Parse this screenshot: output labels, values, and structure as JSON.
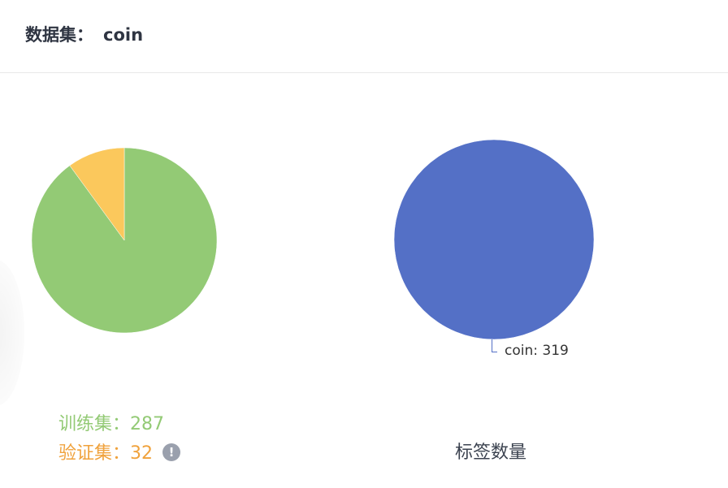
{
  "header": {
    "label": "数据集：",
    "dataset_name": "coin"
  },
  "split_chart": {
    "train_label": "训练集：",
    "train_count": 287,
    "val_label": "验证集：",
    "val_count": 32,
    "info_icon": "info-icon",
    "colors": {
      "train": "#93ca75",
      "val": "#fbc85c"
    }
  },
  "label_chart": {
    "title": "标签数量",
    "slice_label": "coin: 319",
    "color": "#5470c6"
  },
  "chart_data": [
    {
      "type": "pie",
      "labels": [
        "训练集",
        "验证集"
      ],
      "values": [
        287,
        32
      ]
    },
    {
      "type": "pie",
      "title": "标签数量",
      "labels": [
        "coin"
      ],
      "values": [
        319
      ]
    }
  ]
}
